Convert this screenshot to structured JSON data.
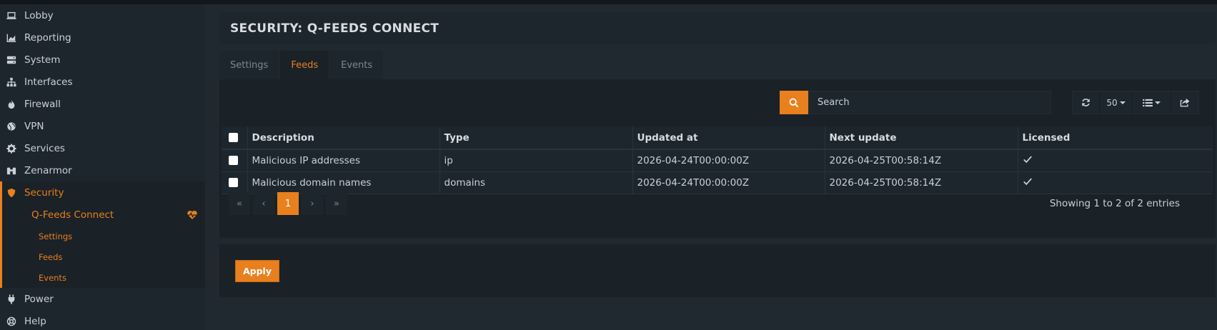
{
  "sidebar": {
    "items": [
      {
        "label": "Lobby",
        "icon": "laptop-icon"
      },
      {
        "label": "Reporting",
        "icon": "chart-icon"
      },
      {
        "label": "System",
        "icon": "server-icon"
      },
      {
        "label": "Interfaces",
        "icon": "sitemap-icon"
      },
      {
        "label": "Firewall",
        "icon": "fire-icon"
      },
      {
        "label": "VPN",
        "icon": "globe-icon"
      },
      {
        "label": "Services",
        "icon": "gear-icon"
      },
      {
        "label": "Zenarmor",
        "icon": "binoculars-icon"
      },
      {
        "label": "Security",
        "icon": "shield-icon"
      }
    ],
    "submenu": {
      "label": "Q-Feeds Connect",
      "icon": "heartbeat-icon",
      "children": [
        "Settings",
        "Feeds",
        "Events"
      ]
    },
    "bottom_items": [
      {
        "label": "Power",
        "icon": "plug-icon"
      },
      {
        "label": "Help",
        "icon": "lifebuoy-icon"
      }
    ]
  },
  "header": {
    "title": "SECURITY: Q-FEEDS CONNECT"
  },
  "tabs": [
    {
      "label": "Settings",
      "active": false
    },
    {
      "label": "Feeds",
      "active": true
    },
    {
      "label": "Events",
      "active": false
    }
  ],
  "toolbar": {
    "search_placeholder": "Search",
    "page_size": "50",
    "icons": [
      "search-icon",
      "refresh-icon",
      "list-icon",
      "export-icon"
    ]
  },
  "table": {
    "columns": [
      "Description",
      "Type",
      "Updated at",
      "Next update",
      "Licensed"
    ],
    "rows": [
      {
        "description": "Malicious IP addresses",
        "type": "ip",
        "updated_at": "2026-04-24T00:00:00Z",
        "next_update": "2026-04-25T00:58:14Z",
        "licensed": true
      },
      {
        "description": "Malicious domain names",
        "type": "domains",
        "updated_at": "2026-04-24T00:00:00Z",
        "next_update": "2026-04-25T00:58:14Z",
        "licensed": true
      }
    ]
  },
  "pagination": {
    "first": "«",
    "prev": "‹",
    "current": "1",
    "next": "›",
    "last": "»",
    "summary": "Showing 1 to 2 of 2 entries"
  },
  "footer": {
    "apply_label": "Apply"
  },
  "colors": {
    "accent": "#e8801e",
    "background": "#202830",
    "panel": "#1a2127"
  }
}
